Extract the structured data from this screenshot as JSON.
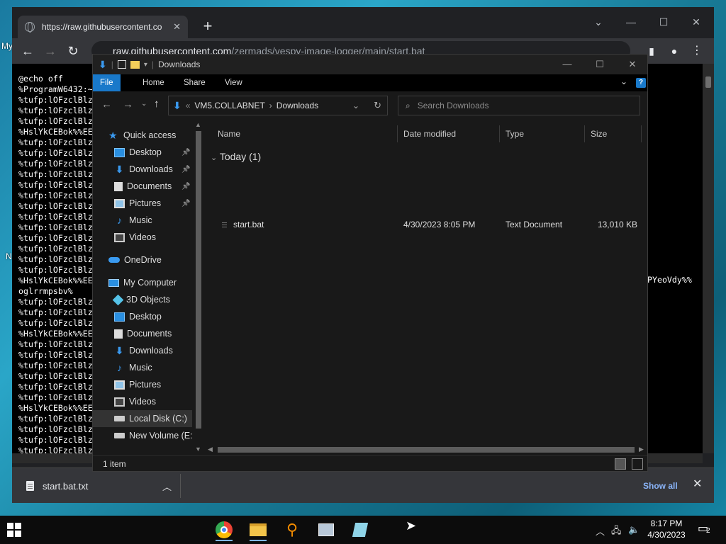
{
  "desktop": {
    "fragments": [
      "My",
      "N"
    ]
  },
  "chrome": {
    "tab_title": "https://raw.githubusercontent.co",
    "tab_close": "✕",
    "new_tab": "+",
    "url_host": "raw.githubusercontent.com",
    "url_path": "/zermads/vespy-image-logger/main/start.bat",
    "window_controls": {
      "minimize": "—",
      "maximize": "☐",
      "close": "✕"
    },
    "content_lines": [
      "@echo off",
      "%ProgramW6432:~",
      "%tufp:lOFzclBlz",
      "%tufp:lOFzclBlz",
      "%tufp:lOFzclBlz",
      "%HslYkCEBok%%EE",
      "%tufp:lOFzclBlz",
      "%tufp:lOFzclBlz",
      "%tufp:lOFzclBlz",
      "%tufp:lOFzclBlz",
      "%tufp:lOFzclBlz",
      "%tufp:lOFzclBlz",
      "%tufp:lOFzclBlz",
      "%tufp:lOFzclBlz",
      "%tufp:lOFzclBlz",
      "%tufp:lOFzclBlz",
      "%tufp:lOFzclBlz",
      "%tufp:lOFzclBlz",
      "%tufp:lOFzclBlz",
      "%HslYkCEBok%%EE",
      "oglrrmpsbv%",
      "%tufp:lOFzclBlz",
      "%tufp:lOFzclBlz",
      "%tufp:lOFzclBlz",
      "%HslYkCEBok%%EE",
      "%tufp:lOFzclBlz",
      "%tufp:lOFzclBlz",
      "%tufp:lOFzclBlz",
      "%tufp:lOFzclBlz",
      "%tufp:lOFzclBlz",
      "%tufp:lOFzclBlz",
      "%HslYkCEBok%%EE",
      "%tufp:lOFzclBlz",
      "%tufp:lOFzclBlz",
      "%tufp:lOFzclBlz",
      "%tufp:lOFzclBlz"
    ],
    "content_right": "PYeoVdy%%",
    "download": {
      "filename": "start.bat.txt",
      "show_all": "Show all",
      "close": "✕"
    }
  },
  "explorer": {
    "title": "Downloads",
    "window_controls": {
      "minimize": "—",
      "maximize": "☐",
      "close": "✕"
    },
    "ribbon_tabs": [
      "File",
      "Home",
      "Share",
      "View"
    ],
    "address": {
      "root": "VM5.COLLABNET",
      "current": "Downloads"
    },
    "search_placeholder": "Search Downloads",
    "nav_items": [
      {
        "label": "Quick access",
        "icon": "star-icon",
        "pinned": false
      },
      {
        "label": "Desktop",
        "icon": "desktop-folder-icon",
        "pinned": true
      },
      {
        "label": "Downloads",
        "icon": "downloads-folder-icon",
        "pinned": true
      },
      {
        "label": "Documents",
        "icon": "documents-folder-icon",
        "pinned": true
      },
      {
        "label": "Pictures",
        "icon": "pictures-folder-icon",
        "pinned": true
      },
      {
        "label": "Music",
        "icon": "music-folder-icon",
        "pinned": false
      },
      {
        "label": "Videos",
        "icon": "videos-folder-icon",
        "pinned": false
      },
      {
        "label": "OneDrive",
        "icon": "onedrive-cloud-icon",
        "pinned": false
      },
      {
        "label": "My Computer",
        "icon": "computer-icon",
        "pinned": false
      },
      {
        "label": "3D Objects",
        "icon": "3d-objects-icon",
        "pinned": false
      },
      {
        "label": "Desktop",
        "icon": "desktop-folder-icon",
        "pinned": false
      },
      {
        "label": "Documents",
        "icon": "documents-folder-icon",
        "pinned": false
      },
      {
        "label": "Downloads",
        "icon": "downloads-folder-icon",
        "pinned": false
      },
      {
        "label": "Music",
        "icon": "music-folder-icon",
        "pinned": false
      },
      {
        "label": "Pictures",
        "icon": "pictures-folder-icon",
        "pinned": false
      },
      {
        "label": "Videos",
        "icon": "videos-folder-icon",
        "pinned": false
      },
      {
        "label": "Local Disk (C:)",
        "icon": "local-disk-icon",
        "pinned": false
      },
      {
        "label": "New Volume (E:)",
        "icon": "drive-icon",
        "pinned": false
      }
    ],
    "columns": [
      "Name",
      "Date modified",
      "Type",
      "Size"
    ],
    "group_label": "Today (1)",
    "files": [
      {
        "name": "start.bat",
        "date": "4/30/2023 8:05 PM",
        "type": "Text Document",
        "size": "13,010 KB"
      }
    ],
    "status": "1 item"
  },
  "taskbar": {
    "apps": [
      "chrome-icon",
      "file-explorer-icon",
      "search-tool-icon",
      "network-app-icon",
      "notepad-app-icon"
    ],
    "time": "8:17 PM",
    "date": "4/30/2023",
    "notification_count": "2"
  },
  "colors": {
    "accent": "#1979ca",
    "chrome_bg": "#202124",
    "explorer_bg": "#191919",
    "link": "#8ab4f8"
  }
}
